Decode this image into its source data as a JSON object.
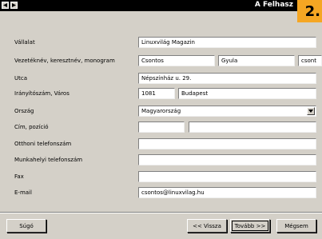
{
  "window": {
    "title": "A Felhasz",
    "step_badge": "2."
  },
  "form": {
    "company": {
      "label": "Vállalat",
      "value": "Linuxvilág Magazin"
    },
    "name": {
      "label": "Vezetéknév, keresztnév, monogram",
      "last": "Csontos",
      "first": "Gyula",
      "initials": "csont"
    },
    "street": {
      "label": "Utca",
      "value": "Népszínház u. 29."
    },
    "zip_city": {
      "label": "Irányítószám, Város",
      "zip": "1081",
      "city": "Budapest"
    },
    "country": {
      "label": "Ország",
      "value": "Magyarország"
    },
    "title_position": {
      "label": "Cím, pozíció",
      "title": "",
      "position": ""
    },
    "home_phone": {
      "label": "Otthoni telefonszám",
      "value": ""
    },
    "work_phone": {
      "label": "Munkahelyi telefonszám",
      "value": ""
    },
    "fax": {
      "label": "Fax",
      "value": ""
    },
    "email": {
      "label": "E-mail",
      "value": "csontos@linuxvilag.hu"
    }
  },
  "buttons": {
    "help": "Súgó",
    "back": "<< Vissza",
    "next": "Tovább >>",
    "cancel": "Mégsem"
  }
}
